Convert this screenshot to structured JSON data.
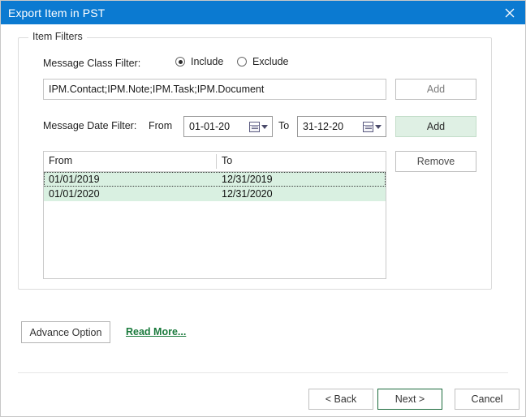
{
  "window": {
    "title": "Export Item in PST",
    "close_icon": "close-icon",
    "titlebar_color": "#0b7ad1"
  },
  "group": {
    "title": "Item Filters"
  },
  "message_class_filter": {
    "label": "Message Class Filter:",
    "options": [
      {
        "label": "Include",
        "selected": true
      },
      {
        "label": "Exclude",
        "selected": false
      }
    ],
    "value": "IPM.Contact;IPM.Note;IPM.Task;IPM.Document",
    "placeholder": "",
    "add_label": "Add"
  },
  "message_date_filter": {
    "label": "Message Date Filter:",
    "from_label": "From",
    "from_value": "01-01-20",
    "to_label": "To",
    "to_value": "31-12-20",
    "calendar_icon": "calendar-icon",
    "add_label": "Add",
    "add_highlight_color": "#dff0e4"
  },
  "date_list": {
    "columns": [
      "From",
      "To"
    ],
    "rows": [
      {
        "from": "01/01/2019",
        "to": "12/31/2019",
        "focused": true
      },
      {
        "from": "01/01/2020",
        "to": "12/31/2020",
        "focused": false
      }
    ],
    "selection_color": "#d9f0e1",
    "remove_label": "Remove"
  },
  "options": {
    "advance_label": "Advance Option",
    "read_more_label": "Read More...",
    "read_more_color": "#1a7a3c"
  },
  "footer": {
    "back_label": "< Back",
    "next_label": "Next >",
    "cancel_label": "Cancel",
    "next_focus_color": "#1d6b3d"
  }
}
